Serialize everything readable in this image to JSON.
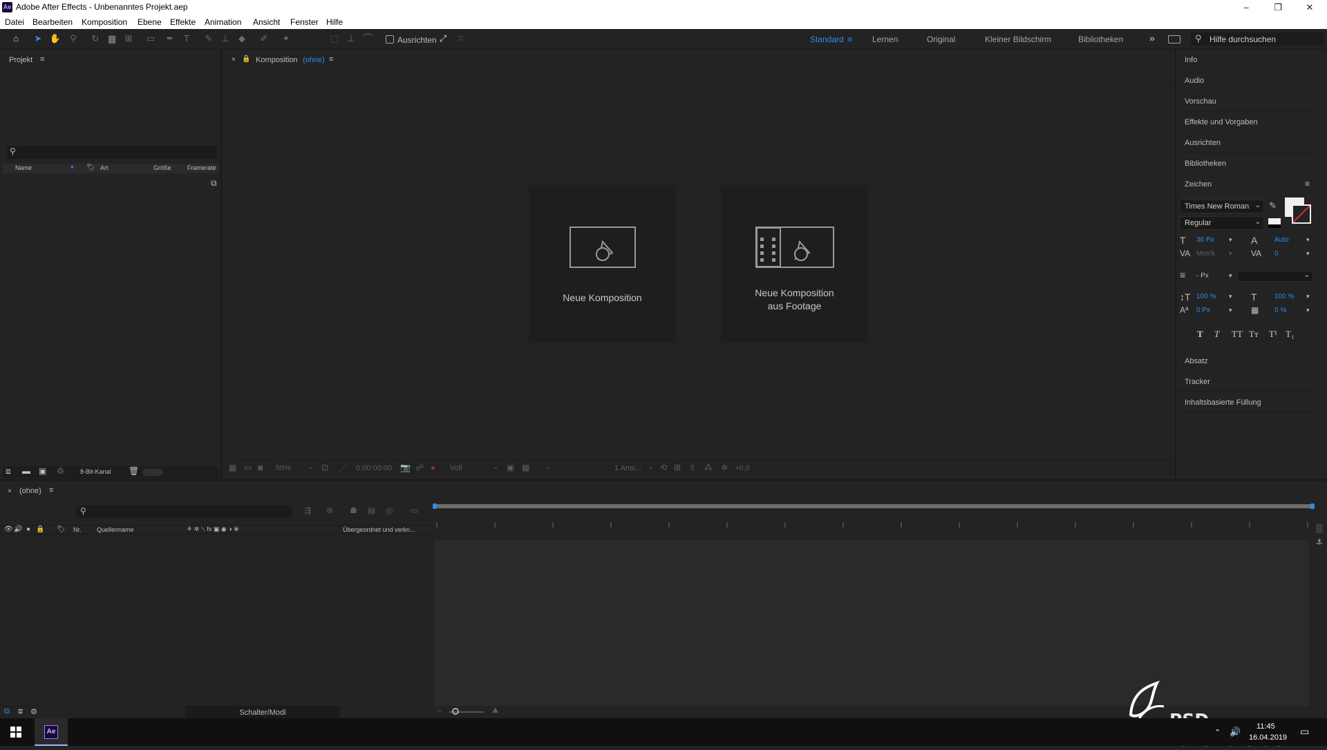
{
  "window": {
    "logo": "Ae",
    "title": "Adobe After Effects - Unbenanntes Projekt.aep",
    "controls": [
      "–",
      "❐",
      "✕"
    ]
  },
  "menu": [
    "Datei",
    "Bearbeiten",
    "Komposition",
    "Ebene",
    "Effekte",
    "Animation",
    "Ansicht",
    "Fenster",
    "Hilfe"
  ],
  "toolbar": {
    "ausrichten_label": "Ausrichten",
    "workspaces": [
      "Standard",
      "Lernen",
      "Original",
      "Kleiner Bildschirm",
      "Bibliotheken"
    ],
    "more": "»",
    "help_placeholder": "Hilfe durchsuchen"
  },
  "project": {
    "title": "Projekt",
    "columns": [
      "Name",
      "Art",
      "Größe",
      "Framerate"
    ],
    "bit_depth": "8-Bit-Kanal"
  },
  "composition": {
    "tab_label": "Komposition",
    "tab_name": "(ohne)",
    "card1": "Neue Komposition",
    "card2_line1": "Neue Komposition",
    "card2_line2": "aus Footage",
    "zoom": "50%",
    "timecode": "0:00:00:00",
    "quality": "Voll",
    "views": "1 Ansi...",
    "exposure": "+0,0"
  },
  "right_panel": {
    "items_top": [
      "Info",
      "Audio",
      "Vorschau",
      "Effekte und Vorgaben",
      "Ausrichten",
      "Bibliotheken"
    ],
    "zeichen": {
      "title": "Zeichen",
      "font": "Times New Roman",
      "style": "Regular",
      "size": "36 Px",
      "leading": "Auto",
      "kerning": "Metrik",
      "tracking": "0",
      "stroke_width": "- Px",
      "vscale": "100 %",
      "hscale": "100 %",
      "baseline": "0 Px",
      "tsume": "0 %",
      "styles": [
        "T",
        "T",
        "TT",
        "Tт",
        "T¹",
        "T₁"
      ]
    },
    "items_bottom": [
      "Absatz",
      "Tracker",
      "Inhaltsbasierte Füllung"
    ]
  },
  "timeline": {
    "tab": "(ohne)",
    "columns": {
      "nr": "Nr.",
      "source": "Quellenname",
      "parent": "Übergeordnet und verkn..."
    },
    "switch_modes": "Schalter/Modi"
  },
  "taskbar": {
    "time": "11:45",
    "date": "16.04.2019",
    "ae_label": "Ae"
  },
  "watermark": "PSD-Tutorials.de",
  "colors": {
    "accent": "#2d8ceb",
    "bg": "#232323"
  }
}
